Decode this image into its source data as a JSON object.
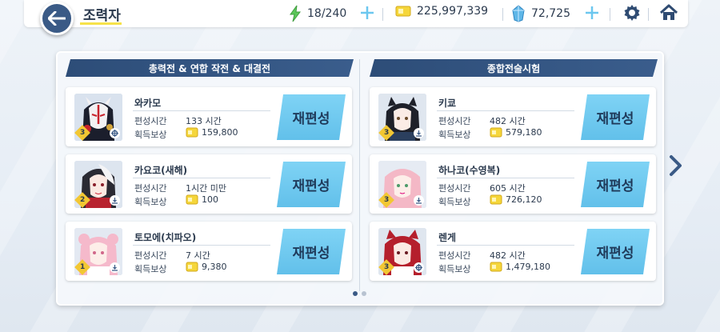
{
  "header": {
    "title": "조력자",
    "back_icon": "arrow-left-icon"
  },
  "resources": {
    "ap": "18/240",
    "credits": "225,997,339",
    "pyroxene": "72,725"
  },
  "columns": [
    {
      "title": "총력전 & 연합 작전 & 대결전",
      "cards": [
        {
          "name": "와카모",
          "time_label": "편성시간",
          "time": "133 시간",
          "reward_label": "획득보상",
          "reward": "159,800",
          "rank": "3",
          "button": "재편성"
        },
        {
          "name": "카요코(새해)",
          "time_label": "편성시간",
          "time": "1시간 미만",
          "reward_label": "획득보상",
          "reward": "100",
          "rank": "2",
          "button": "재편성"
        },
        {
          "name": "토모에(치파오)",
          "time_label": "편성시간",
          "time": "7 시간",
          "reward_label": "획득보상",
          "reward": "9,380",
          "rank": "1",
          "button": "재편성"
        }
      ]
    },
    {
      "title": "종합전술시험",
      "cards": [
        {
          "name": "키쿄",
          "time_label": "편성시간",
          "time": "482 시간",
          "reward_label": "획득보상",
          "reward": "579,180",
          "rank": "3",
          "button": "재편성"
        },
        {
          "name": "하나코(수영복)",
          "time_label": "편성시간",
          "time": "605 시간",
          "reward_label": "획득보상",
          "reward": "726,120",
          "rank": "3",
          "button": "재편성"
        },
        {
          "name": "렌게",
          "time_label": "편성시간",
          "time": "482 시간",
          "reward_label": "획득보상",
          "reward": "1,479,180",
          "rank": "3",
          "button": "재편성"
        }
      ]
    }
  ],
  "pagination": {
    "pages": 2,
    "current": 1
  },
  "colors": {
    "accent_navy": "#3a5a86",
    "button_blue": "#6cc7ef",
    "ap_green": "#5cc85a",
    "credit_yellow": "#f5d63a",
    "pyroxene_blue": "#5fb7e8"
  }
}
